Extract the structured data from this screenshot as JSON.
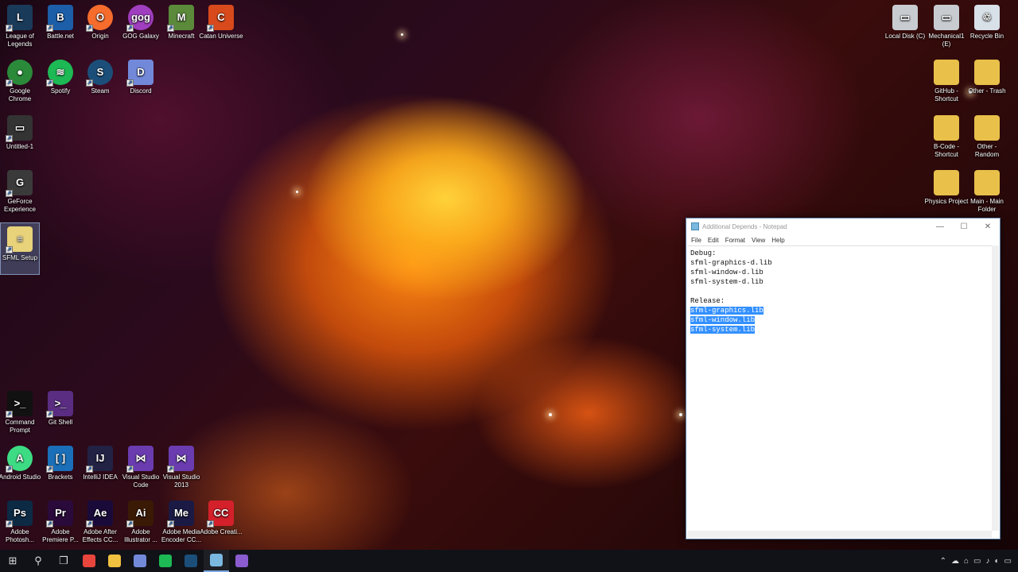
{
  "desktop_icons_left": [
    {
      "label": "League of Legends",
      "icon": "league-of-legends-icon",
      "color": "#1a3a5a",
      "glyph": "L"
    },
    {
      "label": "Battle.net",
      "icon": "battlenet-icon",
      "color": "#1c5ea8",
      "glyph": "B"
    },
    {
      "label": "Origin",
      "icon": "origin-icon",
      "color": "#f56c2d",
      "glyph": "O"
    },
    {
      "label": "GOG Galaxy",
      "icon": "gog-galaxy-icon",
      "color": "#a03ec0",
      "glyph": "gog"
    },
    {
      "label": "Minecraft",
      "icon": "minecraft-icon",
      "color": "#5b8a3a",
      "glyph": "M"
    },
    {
      "label": "Catan Universe",
      "icon": "catan-universe-icon",
      "color": "#d84a1c",
      "glyph": "C"
    },
    {
      "label": "Google Chrome",
      "icon": "chrome-icon",
      "color": "#2a8a3a",
      "glyph": "●"
    },
    {
      "label": "Spotify",
      "icon": "spotify-icon",
      "color": "#1db954",
      "glyph": "≋"
    },
    {
      "label": "Steam",
      "icon": "steam-icon",
      "color": "#1b4f7a",
      "glyph": "S"
    },
    {
      "label": "Discord",
      "icon": "discord-icon",
      "color": "#7289da",
      "glyph": "D"
    },
    {
      "label": "Untitled-1",
      "icon": "file-icon",
      "color": "#333333",
      "glyph": "▭"
    },
    {
      "label": "GeForce Experience",
      "icon": "geforce-icon",
      "color": "#3a3a3a",
      "glyph": "G"
    },
    {
      "label": "SFML Setup",
      "icon": "notepad-file-icon",
      "color": "#e8d27a",
      "glyph": "≡"
    },
    {
      "label": "Command Prompt",
      "icon": "command-prompt-icon",
      "color": "#111111",
      "glyph": ">_"
    },
    {
      "label": "Git Shell",
      "icon": "git-shell-icon",
      "color": "#5a2d82",
      "glyph": ">_"
    },
    {
      "label": "Android Studio",
      "icon": "android-studio-icon",
      "color": "#3ddc84",
      "glyph": "A"
    },
    {
      "label": "Brackets",
      "icon": "brackets-icon",
      "color": "#1a6fb8",
      "glyph": "[ ]"
    },
    {
      "label": "IntelliJ IDEA",
      "icon": "intellij-icon",
      "color": "#222244",
      "glyph": "IJ"
    },
    {
      "label": "Visual Studio Code",
      "icon": "vs-code-icon",
      "color": "#6a3cb0",
      "glyph": "⋈"
    },
    {
      "label": "Visual Studio 2013",
      "icon": "visual-studio-icon",
      "color": "#6a3cb0",
      "glyph": "⋈"
    },
    {
      "label": "Adobe Photosh...",
      "icon": "photoshop-icon",
      "color": "#0c2a44",
      "glyph": "Ps"
    },
    {
      "label": "Adobe Premiere P...",
      "icon": "premiere-icon",
      "color": "#2a0a3a",
      "glyph": "Pr"
    },
    {
      "label": "Adobe After Effects CC...",
      "icon": "after-effects-icon",
      "color": "#1a0a3a",
      "glyph": "Ae"
    },
    {
      "label": "Adobe Illustrator ...",
      "icon": "illustrator-icon",
      "color": "#3a1a05",
      "glyph": "Ai"
    },
    {
      "label": "Adobe Media Encoder CC...",
      "icon": "media-encoder-icon",
      "color": "#1a1a44",
      "glyph": "Me"
    },
    {
      "label": "Adobe Creati...",
      "icon": "creative-cloud-icon",
      "color": "#d4202a",
      "glyph": "CC"
    }
  ],
  "desktop_icons_right": [
    {
      "label": "Local Disk (C)",
      "icon": "local-disk-icon",
      "color": "#c8ccd0",
      "glyph": "▭"
    },
    {
      "label": "Mechanical1 (E)",
      "icon": "drive-icon",
      "color": "#c8ccd0",
      "glyph": "▭"
    },
    {
      "label": "Recycle Bin",
      "icon": "recycle-bin-icon",
      "color": "#d8e0e8",
      "glyph": "♲"
    },
    {
      "label": "GitHub - Shortcut",
      "icon": "folder-icon",
      "color": "#e8c04a",
      "glyph": ""
    },
    {
      "label": "Other - Trash",
      "icon": "folder-icon",
      "color": "#e8c04a",
      "glyph": ""
    },
    {
      "label": "B-Code - Shortcut",
      "icon": "folder-icon",
      "color": "#e8c04a",
      "glyph": ""
    },
    {
      "label": "Other - Random",
      "icon": "folder-icon",
      "color": "#e8c04a",
      "glyph": ""
    },
    {
      "label": "Physics Project",
      "icon": "folder-icon",
      "color": "#e8c04a",
      "glyph": ""
    },
    {
      "label": "Main - Main Folder",
      "icon": "folder-icon",
      "color": "#e8c04a",
      "glyph": ""
    }
  ],
  "notepad": {
    "title": "Additional Depends - Notepad",
    "menu": [
      "File",
      "Edit",
      "Format",
      "View",
      "Help"
    ],
    "controls": {
      "minimize": "—",
      "maximize": "☐",
      "close": "✕"
    },
    "lines": [
      {
        "text": "Debug:",
        "selected": false
      },
      {
        "text": "sfml-graphics-d.lib",
        "selected": false
      },
      {
        "text": "sfml-window-d.lib",
        "selected": false
      },
      {
        "text": "sfml-system-d.lib",
        "selected": false
      },
      {
        "text": "",
        "selected": false
      },
      {
        "text": "Release:",
        "selected": false
      },
      {
        "text": "sfml-graphics.lib",
        "selected": true
      },
      {
        "text": "sfml-window.lib",
        "selected": true
      },
      {
        "text": "sfml-system.lib",
        "selected": true
      }
    ]
  },
  "taskbar": {
    "start": "⊞",
    "search": "⚲",
    "task_view": "❐",
    "apps": [
      {
        "name": "chrome",
        "icon": "chrome-icon",
        "color": "#e8453c",
        "active": false
      },
      {
        "name": "file-explorer",
        "icon": "file-explorer-icon",
        "color": "#f0c040",
        "active": false
      },
      {
        "name": "discord",
        "icon": "discord-icon",
        "color": "#7289da",
        "active": false
      },
      {
        "name": "spotify",
        "icon": "spotify-icon",
        "color": "#1db954",
        "active": false
      },
      {
        "name": "steam",
        "icon": "steam-icon",
        "color": "#1b4f7a",
        "active": false
      },
      {
        "name": "notepad",
        "icon": "notepad-icon",
        "color": "#7ab8e0",
        "active": true
      },
      {
        "name": "visual-studio",
        "icon": "visual-studio-icon",
        "color": "#8a5cd0",
        "active": false
      }
    ],
    "tray": [
      "⌃",
      "☁",
      "⌂",
      "▭",
      "♪",
      "◐",
      "▭"
    ]
  }
}
